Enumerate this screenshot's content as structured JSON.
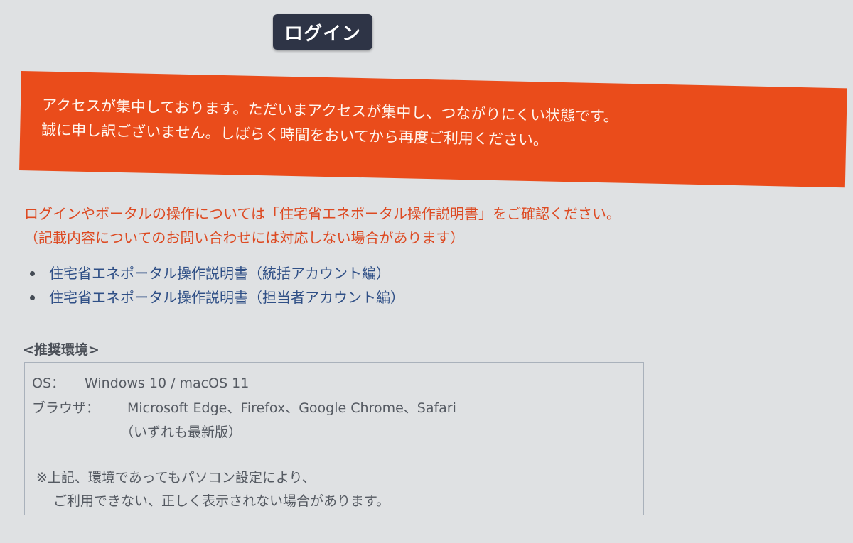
{
  "login_button": {
    "label": "ログイン"
  },
  "alert": {
    "line1": "アクセスが集中しております。ただいまアクセスが集中し、つながりにくい状態です。",
    "line2": "誠に申し訳ございません。しばらく時間をおいてから再度ご利用ください。",
    "background_color": "#ea4c1b"
  },
  "notice": {
    "line1": "ログインやポータルの操作については「住宅省エネポータル操作説明書」をご確認ください。",
    "line2": "（記載内容についてのお問い合わせには対応しない場合があります）",
    "color": "#dd4a22"
  },
  "manuals": [
    {
      "label": "住宅省エネポータル操作説明書（統括アカウント編）"
    },
    {
      "label": "住宅省エネポータル操作説明書（担当者アカウント編）"
    }
  ],
  "environment": {
    "heading": "<推奨環境>",
    "os_label": "OS：",
    "os_value": "Windows 10 / macOS 11",
    "browser_label": "ブラウザ：",
    "browser_value": "Microsoft Edge、Firefox、Google Chrome、Safari",
    "browser_note": "（いずれも最新版）",
    "caution_line1": "※上記、環境であってもパソコン設定により、",
    "caution_line2": "ご利用できない、正しく表示されない場合があります。"
  }
}
